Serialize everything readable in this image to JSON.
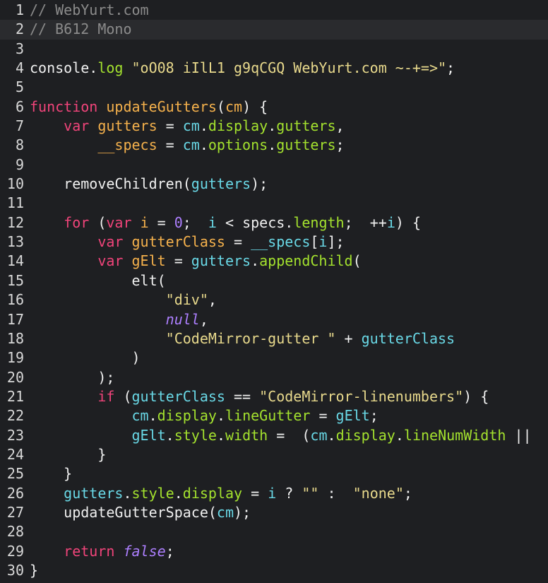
{
  "editor": {
    "colors": {
      "background": "#1e1f22",
      "active_line": "#2a2b2e",
      "comment": "#8b8b8b",
      "keyword": "#f0447a",
      "def": "#f5b14c",
      "variable": "#a4e22e",
      "variable2": "#69d8e6",
      "string": "#e8d98c",
      "number": "#ad7fff"
    },
    "active_line": 2,
    "lines": [
      {
        "n": "1",
        "tokens": [
          {
            "t": "// WebYurt.com",
            "c": "comment"
          }
        ]
      },
      {
        "n": "2",
        "tokens": [
          {
            "t": "// B612 Mono",
            "c": "comment"
          }
        ]
      },
      {
        "n": "3",
        "tokens": []
      },
      {
        "n": "4",
        "tokens": [
          {
            "t": "console",
            "c": "plain"
          },
          {
            "t": ".",
            "c": "punct"
          },
          {
            "t": "log",
            "c": "prop"
          },
          {
            "t": " ",
            "c": "plain"
          },
          {
            "t": "\"oO08 iIlL1 g9qCGQ WebYurt.com ~-+=>\"",
            "c": "string"
          },
          {
            "t": ";",
            "c": "punct"
          }
        ]
      },
      {
        "n": "5",
        "tokens": []
      },
      {
        "n": "6",
        "tokens": [
          {
            "t": "function",
            "c": "keyword"
          },
          {
            "t": " ",
            "c": "plain"
          },
          {
            "t": "updateGutters",
            "c": "def"
          },
          {
            "t": "(",
            "c": "bracket"
          },
          {
            "t": "cm",
            "c": "def"
          },
          {
            "t": ") {",
            "c": "bracket"
          }
        ]
      },
      {
        "n": "7",
        "tokens": [
          {
            "t": "    ",
            "c": "plain"
          },
          {
            "t": "var",
            "c": "keyword"
          },
          {
            "t": " ",
            "c": "plain"
          },
          {
            "t": "gutters",
            "c": "def"
          },
          {
            "t": " = ",
            "c": "plain"
          },
          {
            "t": "cm",
            "c": "var2"
          },
          {
            "t": ".",
            "c": "punct"
          },
          {
            "t": "display",
            "c": "prop"
          },
          {
            "t": ".",
            "c": "punct"
          },
          {
            "t": "gutters",
            "c": "prop"
          },
          {
            "t": ",",
            "c": "punct"
          }
        ]
      },
      {
        "n": "8",
        "tokens": [
          {
            "t": "        ",
            "c": "plain"
          },
          {
            "t": "__specs",
            "c": "def"
          },
          {
            "t": " = ",
            "c": "plain"
          },
          {
            "t": "cm",
            "c": "var2"
          },
          {
            "t": ".",
            "c": "punct"
          },
          {
            "t": "options",
            "c": "prop"
          },
          {
            "t": ".",
            "c": "punct"
          },
          {
            "t": "gutters",
            "c": "prop"
          },
          {
            "t": ";",
            "c": "punct"
          }
        ]
      },
      {
        "n": "9",
        "tokens": []
      },
      {
        "n": "10",
        "tokens": [
          {
            "t": "    ",
            "c": "plain"
          },
          {
            "t": "removeChildren",
            "c": "plain"
          },
          {
            "t": "(",
            "c": "bracket"
          },
          {
            "t": "gutters",
            "c": "var2"
          },
          {
            "t": ");",
            "c": "bracket"
          }
        ]
      },
      {
        "n": "11",
        "tokens": []
      },
      {
        "n": "12",
        "tokens": [
          {
            "t": "    ",
            "c": "plain"
          },
          {
            "t": "for",
            "c": "keyword"
          },
          {
            "t": " (",
            "c": "bracket"
          },
          {
            "t": "var",
            "c": "keyword"
          },
          {
            "t": " ",
            "c": "plain"
          },
          {
            "t": "i",
            "c": "def"
          },
          {
            "t": " = ",
            "c": "plain"
          },
          {
            "t": "0",
            "c": "number"
          },
          {
            "t": ";  ",
            "c": "punct"
          },
          {
            "t": "i",
            "c": "var2"
          },
          {
            "t": " < ",
            "c": "plain"
          },
          {
            "t": "specs",
            "c": "plain"
          },
          {
            "t": ".",
            "c": "punct"
          },
          {
            "t": "length",
            "c": "prop"
          },
          {
            "t": ";  ",
            "c": "punct"
          },
          {
            "t": "++",
            "c": "plain"
          },
          {
            "t": "i",
            "c": "var2"
          },
          {
            "t": ") {",
            "c": "bracket"
          }
        ]
      },
      {
        "n": "13",
        "tokens": [
          {
            "t": "        ",
            "c": "plain"
          },
          {
            "t": "var",
            "c": "keyword"
          },
          {
            "t": " ",
            "c": "plain"
          },
          {
            "t": "gutterClass",
            "c": "def"
          },
          {
            "t": " = ",
            "c": "plain"
          },
          {
            "t": "__specs",
            "c": "var2"
          },
          {
            "t": "[",
            "c": "bracket"
          },
          {
            "t": "i",
            "c": "var2"
          },
          {
            "t": "];",
            "c": "bracket"
          }
        ]
      },
      {
        "n": "14",
        "tokens": [
          {
            "t": "        ",
            "c": "plain"
          },
          {
            "t": "var",
            "c": "keyword"
          },
          {
            "t": " ",
            "c": "plain"
          },
          {
            "t": "gElt",
            "c": "def"
          },
          {
            "t": " = ",
            "c": "plain"
          },
          {
            "t": "gutters",
            "c": "var2"
          },
          {
            "t": ".",
            "c": "punct"
          },
          {
            "t": "appendChild",
            "c": "prop"
          },
          {
            "t": "(",
            "c": "bracket"
          }
        ]
      },
      {
        "n": "15",
        "tokens": [
          {
            "t": "            ",
            "c": "plain"
          },
          {
            "t": "elt",
            "c": "plain"
          },
          {
            "t": "(",
            "c": "bracket"
          }
        ]
      },
      {
        "n": "16",
        "tokens": [
          {
            "t": "                ",
            "c": "plain"
          },
          {
            "t": "\"div\"",
            "c": "string"
          },
          {
            "t": ",",
            "c": "punct"
          }
        ]
      },
      {
        "n": "17",
        "tokens": [
          {
            "t": "                ",
            "c": "plain"
          },
          {
            "t": "null",
            "c": "atom"
          },
          {
            "t": ",",
            "c": "punct"
          }
        ]
      },
      {
        "n": "18",
        "tokens": [
          {
            "t": "                ",
            "c": "plain"
          },
          {
            "t": "\"CodeMirror-gutter \"",
            "c": "string"
          },
          {
            "t": " + ",
            "c": "plain"
          },
          {
            "t": "gutterClass",
            "c": "var2"
          }
        ]
      },
      {
        "n": "19",
        "tokens": [
          {
            "t": "            ",
            "c": "plain"
          },
          {
            "t": ")",
            "c": "bracket"
          }
        ]
      },
      {
        "n": "20",
        "tokens": [
          {
            "t": "        ",
            "c": "plain"
          },
          {
            "t": ");",
            "c": "bracket"
          }
        ]
      },
      {
        "n": "21",
        "tokens": [
          {
            "t": "        ",
            "c": "plain"
          },
          {
            "t": "if",
            "c": "keyword"
          },
          {
            "t": " (",
            "c": "bracket"
          },
          {
            "t": "gutterClass",
            "c": "var2"
          },
          {
            "t": " == ",
            "c": "plain"
          },
          {
            "t": "\"CodeMirror-linenumbers\"",
            "c": "string"
          },
          {
            "t": ") {",
            "c": "bracket"
          }
        ]
      },
      {
        "n": "22",
        "tokens": [
          {
            "t": "            ",
            "c": "plain"
          },
          {
            "t": "cm",
            "c": "var2"
          },
          {
            "t": ".",
            "c": "punct"
          },
          {
            "t": "display",
            "c": "prop"
          },
          {
            "t": ".",
            "c": "punct"
          },
          {
            "t": "lineGutter",
            "c": "prop"
          },
          {
            "t": " = ",
            "c": "plain"
          },
          {
            "t": "gElt",
            "c": "var2"
          },
          {
            "t": ";",
            "c": "punct"
          }
        ]
      },
      {
        "n": "23",
        "tokens": [
          {
            "t": "            ",
            "c": "plain"
          },
          {
            "t": "gElt",
            "c": "var2"
          },
          {
            "t": ".",
            "c": "punct"
          },
          {
            "t": "style",
            "c": "prop"
          },
          {
            "t": ".",
            "c": "punct"
          },
          {
            "t": "width",
            "c": "prop"
          },
          {
            "t": " = ",
            "c": "plain"
          },
          {
            "t": " (",
            "c": "bracket"
          },
          {
            "t": "cm",
            "c": "var2"
          },
          {
            "t": ".",
            "c": "punct"
          },
          {
            "t": "display",
            "c": "prop"
          },
          {
            "t": ".",
            "c": "punct"
          },
          {
            "t": "lineNumWidth",
            "c": "prop"
          },
          {
            "t": " ||",
            "c": "plain"
          }
        ]
      },
      {
        "n": "24",
        "tokens": [
          {
            "t": "        ",
            "c": "plain"
          },
          {
            "t": "}",
            "c": "bracket"
          }
        ]
      },
      {
        "n": "25",
        "tokens": [
          {
            "t": "    ",
            "c": "plain"
          },
          {
            "t": "}",
            "c": "bracket"
          }
        ]
      },
      {
        "n": "26",
        "tokens": [
          {
            "t": "    ",
            "c": "plain"
          },
          {
            "t": "gutters",
            "c": "var2"
          },
          {
            "t": ".",
            "c": "punct"
          },
          {
            "t": "style",
            "c": "prop"
          },
          {
            "t": ".",
            "c": "punct"
          },
          {
            "t": "display",
            "c": "prop"
          },
          {
            "t": " = ",
            "c": "plain"
          },
          {
            "t": "i",
            "c": "var2"
          },
          {
            "t": " ? ",
            "c": "plain"
          },
          {
            "t": "\"\"",
            "c": "string"
          },
          {
            "t": " :  ",
            "c": "plain"
          },
          {
            "t": "\"none\"",
            "c": "string"
          },
          {
            "t": ";",
            "c": "punct"
          }
        ]
      },
      {
        "n": "27",
        "tokens": [
          {
            "t": "    ",
            "c": "plain"
          },
          {
            "t": "updateGutterSpace",
            "c": "plain"
          },
          {
            "t": "(",
            "c": "bracket"
          },
          {
            "t": "cm",
            "c": "var2"
          },
          {
            "t": ");",
            "c": "bracket"
          }
        ]
      },
      {
        "n": "28",
        "tokens": []
      },
      {
        "n": "29",
        "tokens": [
          {
            "t": "    ",
            "c": "plain"
          },
          {
            "t": "return",
            "c": "keyword"
          },
          {
            "t": " ",
            "c": "plain"
          },
          {
            "t": "false",
            "c": "atom"
          },
          {
            "t": ";",
            "c": "punct"
          }
        ]
      },
      {
        "n": "30",
        "tokens": [
          {
            "t": "}",
            "c": "bracket"
          }
        ]
      }
    ]
  }
}
